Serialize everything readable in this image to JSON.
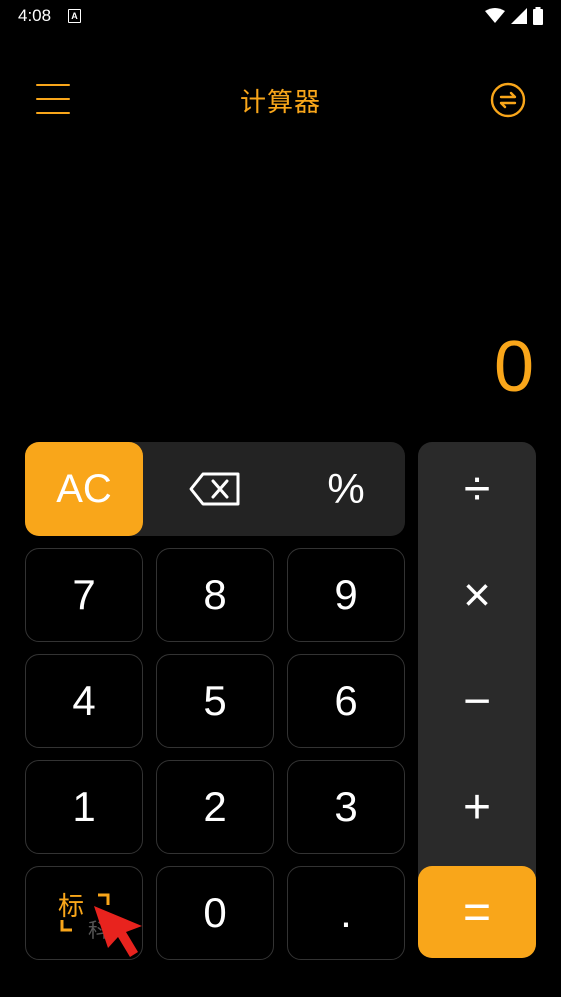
{
  "status_bar": {
    "time": "4:08",
    "notification_badge": "A"
  },
  "app_bar": {
    "title": "计算器"
  },
  "display": {
    "value": "0"
  },
  "keypad": {
    "ac": "AC",
    "percent": "%",
    "divide": "÷",
    "multiply": "×",
    "minus": "−",
    "plus": "+",
    "equals": "=",
    "digits": {
      "d7": "7",
      "d8": "8",
      "d9": "9",
      "d4": "4",
      "d5": "5",
      "d6": "6",
      "d1": "1",
      "d2": "2",
      "d3": "3",
      "d0": "0"
    },
    "dot": ".",
    "mark_key": {
      "line1": "标",
      "line2": "科"
    }
  },
  "colors": {
    "accent": "#f9a61a",
    "background": "#000000",
    "panel": "#232323",
    "cursor": "#e8231e"
  }
}
